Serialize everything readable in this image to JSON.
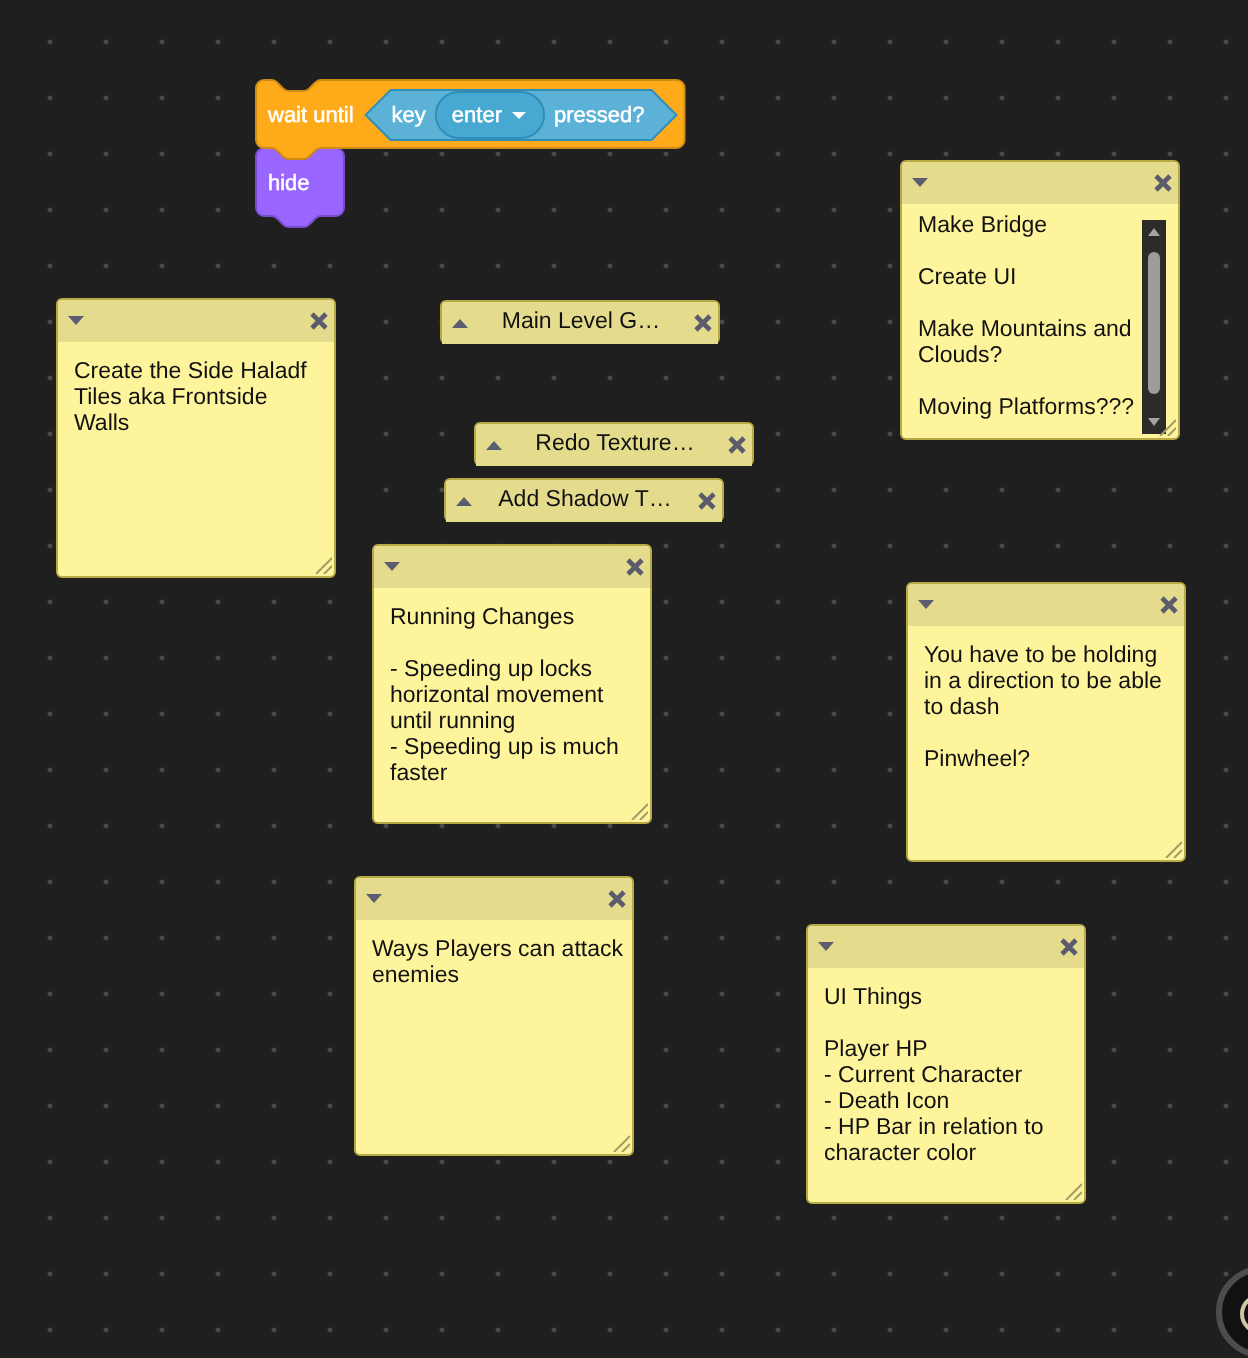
{
  "script": [
    {
      "kind": "control",
      "label": "wait until",
      "condition": {
        "kind": "sensing",
        "label": "key",
        "menu": "enter",
        "suffix": "pressed?"
      }
    },
    {
      "kind": "looks",
      "label": "hide"
    }
  ],
  "comments": [
    {
      "expanded": true,
      "scrollbar": true,
      "text": "Make Bridge\n\nCreate UI\n\nMake Mountains and Clouds?\n\nMoving Platforms???"
    },
    {
      "expanded": true,
      "scrollbar": false,
      "text": "Create the Side Haladf Tiles aka Frontside Walls"
    },
    {
      "expanded": false,
      "text": "Main Level G…"
    },
    {
      "expanded": false,
      "text": "Redo Texture…"
    },
    {
      "expanded": false,
      "text": "Add Shadow T…"
    },
    {
      "expanded": true,
      "scrollbar": false,
      "text": "Running Changes\n\n- Speeding up locks horizontal movement until running\n- Speeding up is much faster"
    },
    {
      "expanded": true,
      "scrollbar": false,
      "text": "You have to be holding in a direction to be able to dash\n\nPinwheel?"
    },
    {
      "expanded": true,
      "scrollbar": false,
      "text": "Ways Players can attack enemies"
    },
    {
      "expanded": true,
      "scrollbar": false,
      "text": "UI Things\n\nPlayer HP\n- Current Character\n- Death Icon\n- HP Bar in relation to character color"
    }
  ]
}
